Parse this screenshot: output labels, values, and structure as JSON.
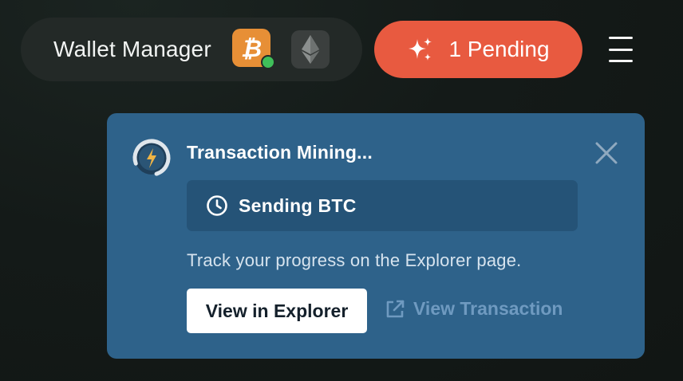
{
  "header": {
    "wallet_title": "Wallet Manager",
    "coins": [
      {
        "name": "BTC",
        "icon": "bitcoin-icon",
        "color": "#e78f36",
        "active": true
      },
      {
        "name": "ETH",
        "icon": "ethereum-icon",
        "color": "#3b3f3e",
        "active": false
      }
    ],
    "status_color": "#3fbf5a",
    "pending_label": "1 Pending",
    "pending_icon": "sparkles-icon",
    "pending_color": "#e85a40",
    "menu_icon": "hamburger-menu-icon"
  },
  "notification": {
    "title": "Transaction Mining...",
    "status_icon": "clock-icon",
    "status_text": "Sending BTC",
    "description": "Track your progress on the Explorer page.",
    "primary_action": "View in Explorer",
    "secondary_action": "View Transaction",
    "secondary_icon": "external-link-icon",
    "close_icon": "close-icon",
    "background": "#2e628a"
  }
}
